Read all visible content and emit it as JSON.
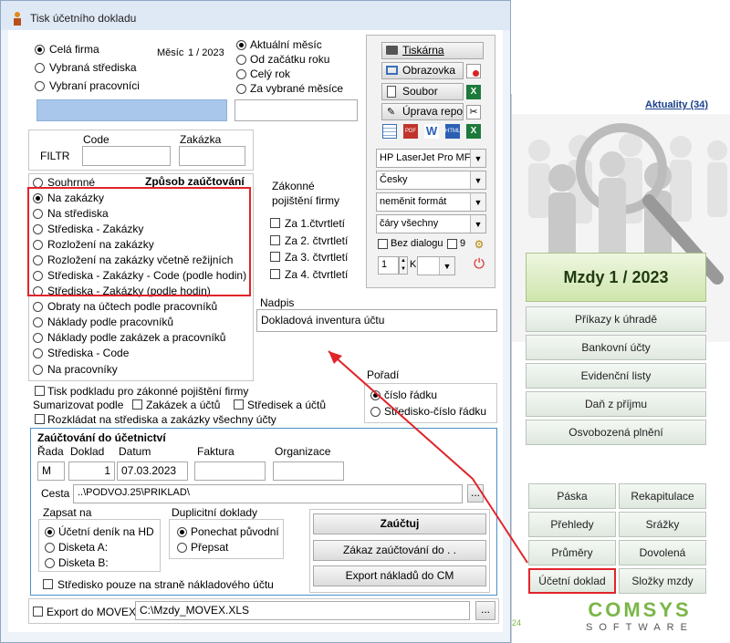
{
  "window": {
    "title": "Tisk účetního dokladu"
  },
  "scope": {
    "options": [
      "Celá firma",
      "Vybraná střediska",
      "Vybraní pracovníci"
    ],
    "selected": 0,
    "month_label": "Měsíc",
    "month_value": "1 / 2023"
  },
  "period": {
    "options": [
      "Aktuální měsíc",
      "Od začátku roku",
      "Celý rok",
      "Za vybrané měsíce"
    ],
    "selected": 0
  },
  "filter": {
    "label": "FILTR",
    "code_label": "Code",
    "order_label": "Zakázka"
  },
  "method": {
    "title": "Způsob zaúčtování",
    "options": [
      "Souhrnné",
      "Na zakázky",
      "Na střediska",
      "Střediska - Zakázky",
      "Rozložení na zakázky",
      "Rozložení na zakázky včetně režijních",
      "Střediska - Zakázky - Code (podle hodin)",
      "Střediska - Zakázky (podle hodin)",
      "Obraty na účtech podle pracovníků",
      "Náklady podle pracovníků",
      "Náklady podle zakázek a pracovníků",
      "Střediska - Code",
      "Na pracovníky"
    ],
    "selected": 1
  },
  "insurance": {
    "title_line1": "Zákonné",
    "title_line2": "pojištění firmy",
    "quarters": [
      "Za 1.čtvrtletí",
      "Za 2. čtvrtletí",
      "Za 3. čtvrtletí",
      "Za 4. čtvrtletí"
    ]
  },
  "output": {
    "printer_btn": "Tiskárna",
    "screen_btn": "Obrazovka",
    "file_btn": "Soubor",
    "edit_btn": "Úprava repor"
  },
  "print": {
    "printer": "HP LaserJet Pro MFP",
    "language": "Česky",
    "format": "neměnit formát",
    "lines": "čáry všechny",
    "no_dialog": "Bez dialogu",
    "copies_check": "9",
    "copies": "1",
    "k_label": "K"
  },
  "heading": {
    "label": "Nadpis",
    "value": "Dokladová inventura účtu"
  },
  "extra": {
    "print_insurance": "Tisk podkladu pro zákonné pojištění firmy",
    "summarize": "Sumarizovat podle",
    "sum_orders": "Zakázek a účtů",
    "sum_centers": "Středisek a účtů",
    "split": "Rozkládat na střediska a zakázky všechny účty"
  },
  "order": {
    "label": "Pořadí",
    "options": [
      "číslo řádku",
      "Středisko-číslo řádku"
    ],
    "selected": 0
  },
  "posting": {
    "title": "Zaúčtování do účetnictví",
    "series_label": "Řada",
    "series": "M",
    "doc_label": "Doklad",
    "doc": "1",
    "date_label": "Datum",
    "date": "07.03.2023",
    "invoice_label": "Faktura",
    "org_label": "Organizace",
    "path_label": "Cesta",
    "path": "..\\PODVOJ.25\\PRIKLAD\\",
    "write_label": "Zapsat na",
    "write_options": [
      "Účetní deník na HD",
      "Disketa A:",
      "Disketa B:"
    ],
    "write_selected": 0,
    "dup_label": "Duplicitní doklady",
    "dup_options": [
      "Ponechat původní",
      "Přepsat"
    ],
    "dup_selected": 0,
    "center_cost": "Středisko pouze na straně nákladového účtu",
    "post_btn": "Zaúčtuj",
    "cancel_btn": "Zákaz zaúčtování do  . .",
    "export_btn": "Export nákladů do CM"
  },
  "export": {
    "label": "Export do MOVEX",
    "path": "C:\\Mzdy_MOVEX.XLS"
  },
  "browse": "...",
  "bg": {
    "news": "Aktuality (34)",
    "header": "Mzdy  1 / 2023",
    "menu": [
      "Příkazy k úhradě",
      "Bankovní účty",
      "Evidenční listy",
      "Daň z příjmu",
      "Osvobozená plnění"
    ],
    "grid": [
      "Páska",
      "Rekapitulace",
      "Přehledy",
      "Srážky",
      "Průměry",
      "Dovolená",
      "Účetní doklad",
      "Složky mzdy"
    ],
    "logo": "COMSYS",
    "logo_sub": "SOFTWARE",
    "side_digits": "24"
  },
  "colors": {
    "highlight": "#e0242a",
    "arrow": "#e0242a",
    "logo_green": "#7ab648"
  }
}
